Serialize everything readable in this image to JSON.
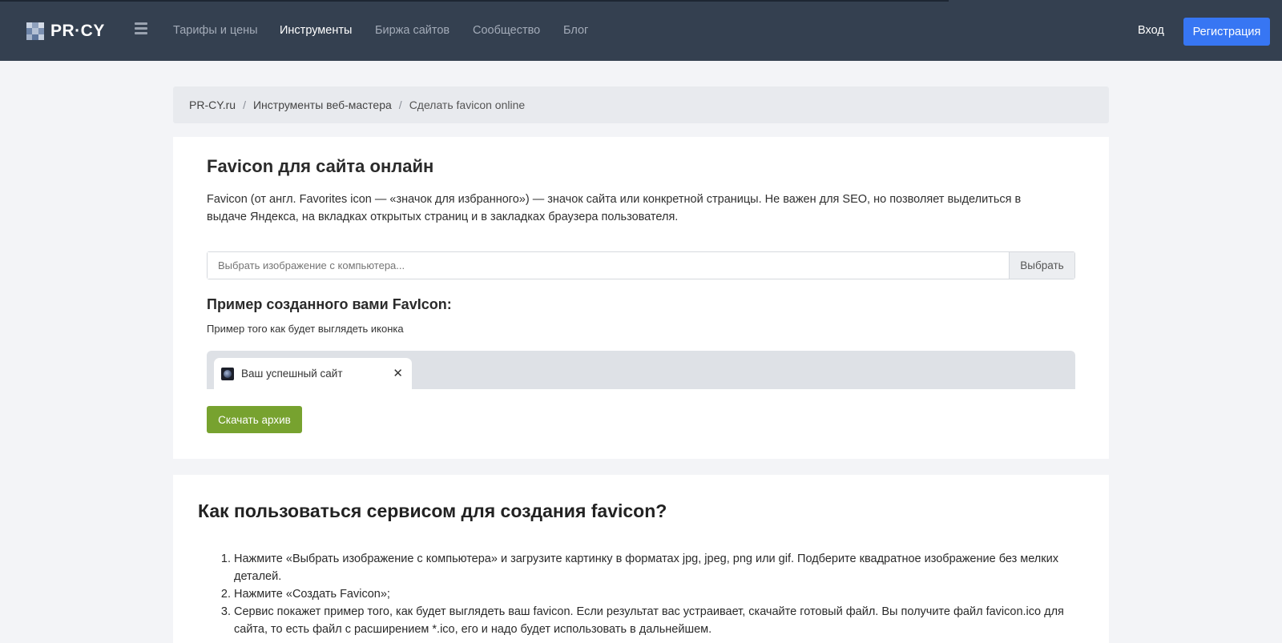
{
  "header": {
    "logo_text": "PR·CY",
    "nav": [
      {
        "label": "Тарифы и цены",
        "active": false
      },
      {
        "label": "Инструменты",
        "active": true
      },
      {
        "label": "Биржа сайтов",
        "active": false
      },
      {
        "label": "Сообщество",
        "active": false
      },
      {
        "label": "Блог",
        "active": false
      }
    ],
    "login": "Вход",
    "register": "Регистрация"
  },
  "breadcrumb": {
    "items": [
      "PR-CY.ru",
      "Инструменты веб-мастера",
      "Сделать favicon online"
    ],
    "separator": "/"
  },
  "tool": {
    "title": "Favicon для сайта онлайн",
    "description": "Favicon (от англ. Favorites icon — «значок для избранного») — значок сайта или конкретной страницы. Не важен для SEO, но позволяет выделиться в выдаче Яндекса, на вкладках открытых страниц и в закладках браузера пользователя.",
    "file_placeholder": "Выбрать изображение с компьютера...",
    "pick_button": "Выбрать",
    "preview_title": "Пример созданного вами FavIcon:",
    "preview_subtitle": "Пример того как будет выглядеть иконка",
    "tab_title": "Ваш успешный сайт",
    "tab_close": "✕",
    "download_button": "Скачать архив"
  },
  "howto": {
    "title": "Как пользоваться сервисом для создания favicon?",
    "steps": [
      "Нажмите «Выбрать изображение с компьютера» и загрузите картинку в форматах jpg, jpeg, png или gif. Подберите квадратное изображение без мелких деталей.",
      "Нажмите «Создать Favicon»;",
      "Сервис покажет пример того, как будет выглядеть ваш favicon. Если результат вас устраивает, скачайте готовый файл. Вы получите файл favicon.ico для сайта, то есть файл с расширением *.ico, его и надо будет использовать в дальнейшем."
    ]
  },
  "colors": {
    "navbar": "#344050",
    "register": "#3776f3",
    "download": "#77a22f"
  }
}
